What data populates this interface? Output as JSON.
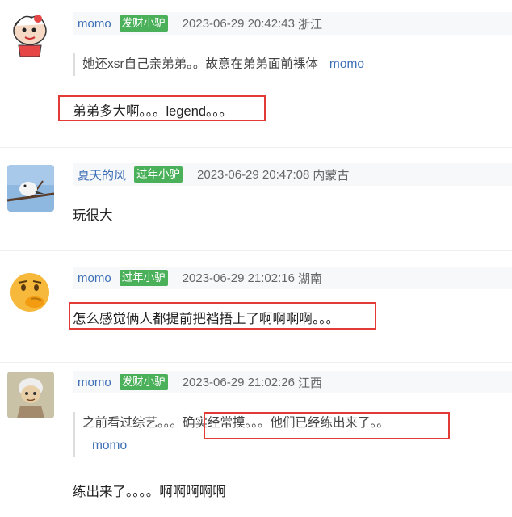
{
  "comments": [
    {
      "user": "momo",
      "badge": "发财小驴",
      "time": "2023-06-29 20:42:43",
      "location": "浙江",
      "avatar": "cartoon-boy-avatar",
      "quote": {
        "text": "她还xsr自己亲弟弟。。故意在弟弟面前裸体",
        "author": "momo"
      },
      "text": "弟弟多大啊。。。legend。。。"
    },
    {
      "user": "夏天的风",
      "badge": "过年小驴",
      "time": "2023-06-29 20:47:08",
      "location": "内蒙古",
      "avatar": "bird-photo-avatar",
      "text": "玩很大"
    },
    {
      "user": "momo",
      "badge": "过年小驴",
      "time": "2023-06-29 21:02:16",
      "location": "湖南",
      "avatar": "thinking-emoji-avatar",
      "text": "怎么感觉俩人都提前把裆捂上了啊啊啊啊。。。"
    },
    {
      "user": "momo",
      "badge": "发财小驴",
      "time": "2023-06-29 21:02:26",
      "location": "江西",
      "avatar": "grandma-cartoon-avatar",
      "quote": {
        "text_before": "之前看过综艺。。。",
        "text_highlight": "确实经常摸。。。他们已经练出来了。。",
        "author": "momo"
      },
      "text": "练出来了。。。。啊啊啊啊啊"
    }
  ],
  "colors": {
    "username": "#3d6fb6",
    "badge": "#4bb05a",
    "highlight_box": "#e23b35"
  }
}
